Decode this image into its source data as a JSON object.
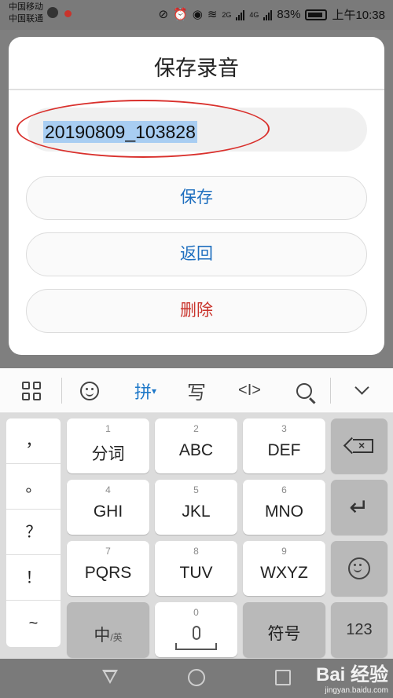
{
  "status_bar": {
    "carrier1": "中国移动",
    "carrier2": "中国联通",
    "network1": "2G",
    "network2": "4G",
    "battery": "83%",
    "time": "上午10:38"
  },
  "dialog": {
    "title": "保存录音",
    "filename": "20190809_103828",
    "save_label": "保存",
    "back_label": "返回",
    "delete_label": "删除"
  },
  "toolbar": {
    "pinyin_label": "拼",
    "write_label": "写",
    "cursor_label": "<I>"
  },
  "keyboard": {
    "punctuation": [
      "，",
      "。",
      "？",
      "！",
      "~"
    ],
    "keys": [
      {
        "num": "1",
        "label": "分词"
      },
      {
        "num": "2",
        "label": "ABC"
      },
      {
        "num": "3",
        "label": "DEF"
      },
      {
        "num": "4",
        "label": "GHI"
      },
      {
        "num": "5",
        "label": "JKL"
      },
      {
        "num": "6",
        "label": "MNO"
      },
      {
        "num": "7",
        "label": "PQRS"
      },
      {
        "num": "8",
        "label": "TUV"
      },
      {
        "num": "9",
        "label": "WXYZ"
      }
    ],
    "zh_label": "中",
    "en_label": "/英",
    "space_num": "0",
    "symbol_label": "符号",
    "num_label": "123"
  },
  "watermark": {
    "brand": "Bai 经验",
    "url": "jingyan.baidu.com"
  }
}
